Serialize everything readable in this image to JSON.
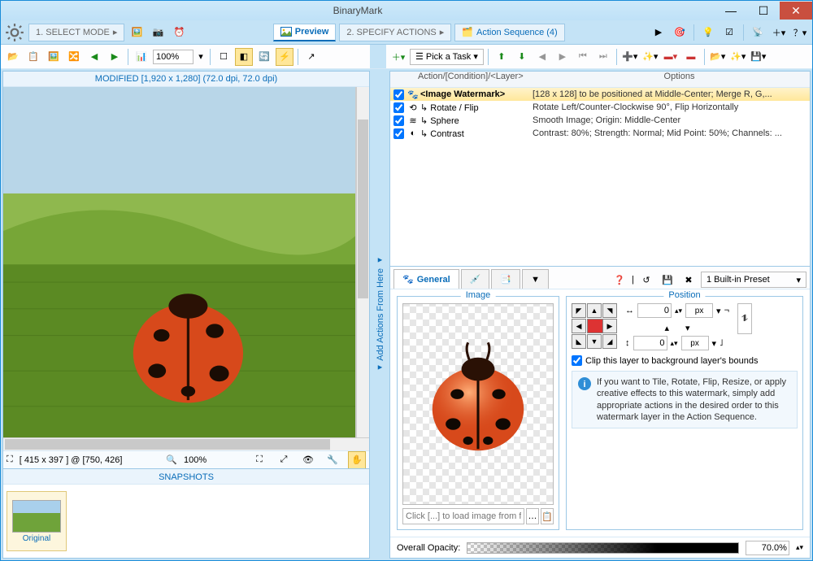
{
  "titlebar": {
    "title": "BinaryMark"
  },
  "steps": {
    "s1": "1. SELECT MODE",
    "preview": "Preview",
    "s2": "2. SPECIFY ACTIONS",
    "seq": "Action Sequence (4)"
  },
  "zoom": "100%",
  "left": {
    "modified": "MODIFIED [1,920 x 1,280] (72.0 dpi, 72.0 dpi)",
    "status_size": "[ 415 x 397 ] @ [750, 426]",
    "status_zoom": "100%",
    "snapshots_header": "SNAPSHOTS",
    "snapshot_label": "Original"
  },
  "mid": {
    "label": "◂  Add Actions From Here  ◂"
  },
  "right": {
    "pick_task": "Pick a Task",
    "head_action": "Action/[Condition]/<Layer>",
    "head_options": "Options",
    "rows": [
      {
        "name": "<Image Watermark>",
        "opt": "[128 x 128] to be positioned at Middle-Center; Merge R, G,..."
      },
      {
        "name": "↳ Rotate / Flip",
        "opt": "Rotate Left/Counter-Clockwise 90°, Flip Horizontally"
      },
      {
        "name": "↳ Sphere",
        "opt": "Smooth Image; Origin: Middle-Center"
      },
      {
        "name": "↳ Contrast",
        "opt": "Contrast: 80%; Strength: Normal; Mid Point: 50%; Channels: ..."
      }
    ],
    "tab_general": "General",
    "preset": "1 Built-in Preset",
    "image_legend": "Image",
    "image_path_placeholder": "Click [...] to load image from file",
    "position_legend": "Position",
    "x_val": "0",
    "y_val": "0",
    "unit": "px",
    "clip": "Clip this layer to background layer's bounds",
    "info": "If you want to Tile, Rotate, Flip, Resize, or apply creative effects to this watermark, simply add appropriate actions in the desired order to this watermark layer in the Action Sequence.",
    "opacity_label": "Overall Opacity:",
    "opacity_val": "70.0%"
  }
}
